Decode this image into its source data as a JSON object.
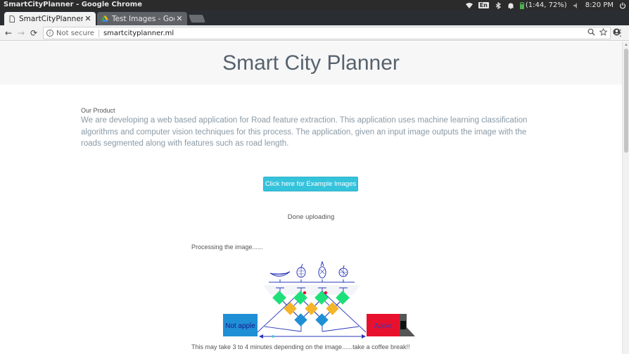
{
  "os": {
    "window_title": "SmartCityPlanner - Google Chrome",
    "language": "En",
    "battery": "(1:44, 72%)",
    "clock": "8:20 PM"
  },
  "tabs": [
    {
      "label": "SmartCityPlanner",
      "close": "✕"
    },
    {
      "label": "Test Images - Goog",
      "close": "✕"
    }
  ],
  "toolbar": {
    "back": "←",
    "forward": "→",
    "reload": "⟳",
    "security": "Not secure",
    "url": "smartcityplanner.ml",
    "menu": "⋮"
  },
  "page": {
    "title": "Smart City Planner",
    "product_label": "Our Product",
    "product_description": "We are developing a web based application for Road feature extraction. This application uses machine learning classification algorithms and computer vision techniques for this process. The application, given an input image outputs the image with the roads segmented along with features such as road length.",
    "example_button": "Click here for Example Images",
    "upload_status": "Done uploading",
    "processing_text": "Processing the image......",
    "wait_text": "This may take 3 to 4 minutes depending on the image......take a coffee break!!"
  },
  "diagram": {
    "input_label": "Not apple",
    "output_label": "Apple"
  },
  "colors": {
    "os_bar": "#2b2b2b",
    "tab_strip": "#2a2d31",
    "hero_bg": "#f7f7f8",
    "title_text": "#56626d",
    "description_text": "#8a9aa6",
    "button_bg": "#35c3dc",
    "node_green": "#1ee07a",
    "node_orange": "#f5b52a",
    "node_blue": "#1f8fd6",
    "box_blue": "#1f8fd6",
    "box_red": "#e8112d",
    "line_blue": "#2a39b8"
  }
}
